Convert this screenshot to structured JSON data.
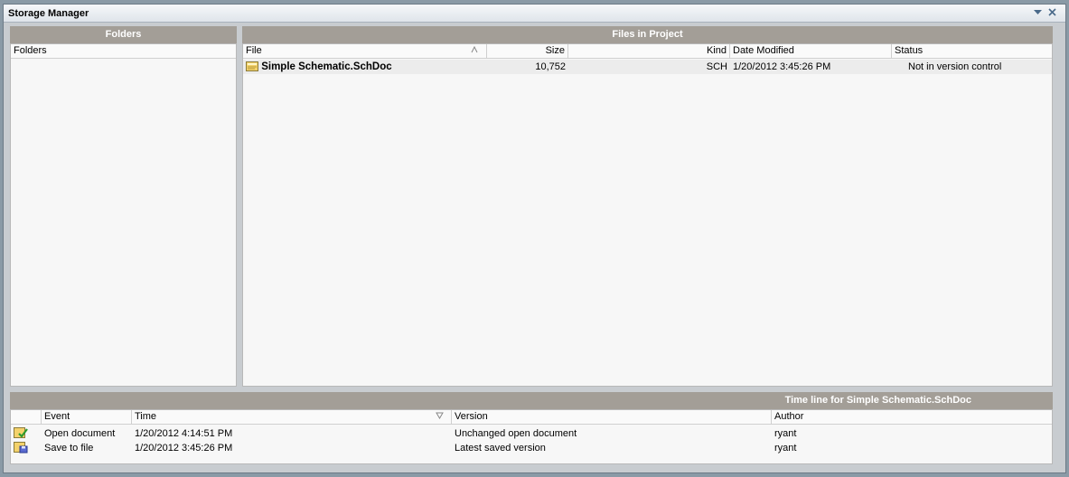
{
  "window": {
    "title": "Storage Manager",
    "menu_icon": "dropdown-arrow-icon",
    "close_icon": "close-icon"
  },
  "folders": {
    "header": "Folders",
    "column": "Folders"
  },
  "files": {
    "header": "Files in Project",
    "columns": {
      "file": "File",
      "size": "Size",
      "kind": "Kind",
      "date_modified": "Date Modified",
      "status": "Status"
    },
    "rows": [
      {
        "icon": "schematic-document-icon",
        "file": "Simple Schematic.SchDoc",
        "size": "10,752",
        "kind": "SCH",
        "date_modified": "1/20/2012 3:45:26 PM",
        "status": "Not in version control"
      }
    ]
  },
  "timeline": {
    "header": "Time line for Simple Schematic.SchDoc",
    "columns": {
      "event": "Event",
      "time": "Time",
      "version": "Version",
      "author": "Author"
    },
    "rows": [
      {
        "icon": "open-document-check-icon",
        "event": "Open document",
        "time": "1/20/2012 4:14:51 PM",
        "version": "Unchanged open document",
        "author": "ryant"
      },
      {
        "icon": "save-document-icon",
        "event": "Save to file",
        "time": "1/20/2012 3:45:26 PM",
        "version": "Latest saved version",
        "author": "ryant"
      }
    ]
  },
  "colors": {
    "panel_header": "#a39e97",
    "list_background": "#f7f7f7",
    "title_accent": "#4a6a8a"
  }
}
